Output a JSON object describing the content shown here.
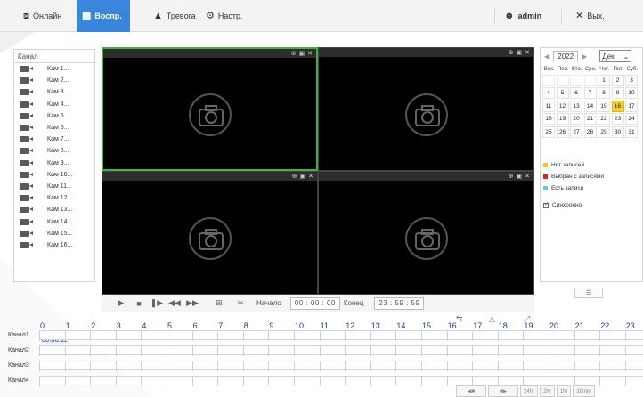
{
  "nav": {
    "online": "Онлайн",
    "playback": "Воспр.",
    "alarm": "Тревога",
    "settings": "Настр.",
    "user": "admin",
    "exit": "Вых."
  },
  "channels": {
    "header": "Канал",
    "items": [
      "Кам 1...",
      "Кам 2...",
      "Кам 3...",
      "Кам 4...",
      "Кам 5...",
      "Кам 6...",
      "Кам 7...",
      "Кам 8...",
      "Кам 9...",
      "Кам 10...",
      "Кам 11...",
      "Кам 12...",
      "Кам 13...",
      "Кам 14...",
      "Кам 15...",
      "Кам 16..."
    ]
  },
  "controls": {
    "start_label": "Начало",
    "start_time": "00 : 00 : 00",
    "end_label": "Конец",
    "end_time": "23 : 59 : 59"
  },
  "calendar": {
    "year": "2022",
    "month": "Дек",
    "weekdays": [
      "Вос.",
      "Пон.",
      "Вто.",
      "Сре.",
      "Чет.",
      "Пят.",
      "Суб."
    ],
    "weeks": [
      [
        "",
        "",
        "",
        "",
        "1",
        "2",
        "3"
      ],
      [
        "4",
        "5",
        "6",
        "7",
        "8",
        "9",
        "10"
      ],
      [
        "11",
        "12",
        "13",
        "14",
        "15",
        "16",
        "17"
      ],
      [
        "18",
        "19",
        "20",
        "21",
        "22",
        "23",
        "24"
      ],
      [
        "25",
        "26",
        "27",
        "28",
        "29",
        "30",
        "31"
      ]
    ],
    "selected_day": "16",
    "legend_none": "Нет записей",
    "legend_selected": "Выбран с записями",
    "legend_has": "Есть записи",
    "sync_label": "Синхронно",
    "colors": {
      "none": "#f2c230",
      "selected": "#d9231f",
      "has": "#6fc0ea",
      "today": "#f3cf2e"
    }
  },
  "timeline": {
    "hours": [
      "0",
      "1",
      "2",
      "3",
      "4",
      "5",
      "6",
      "7",
      "8",
      "9",
      "10",
      "11",
      "12",
      "13",
      "14",
      "15",
      "16",
      "17",
      "18",
      "19",
      "20",
      "21",
      "22",
      "23"
    ],
    "rows": [
      "Канал1",
      "Канал2",
      "Канал3",
      "Канал4"
    ],
    "current_time": "00:06:11"
  },
  "bottom_buttons": [
    "24hr",
    "2hr",
    "1hr",
    "30min"
  ]
}
